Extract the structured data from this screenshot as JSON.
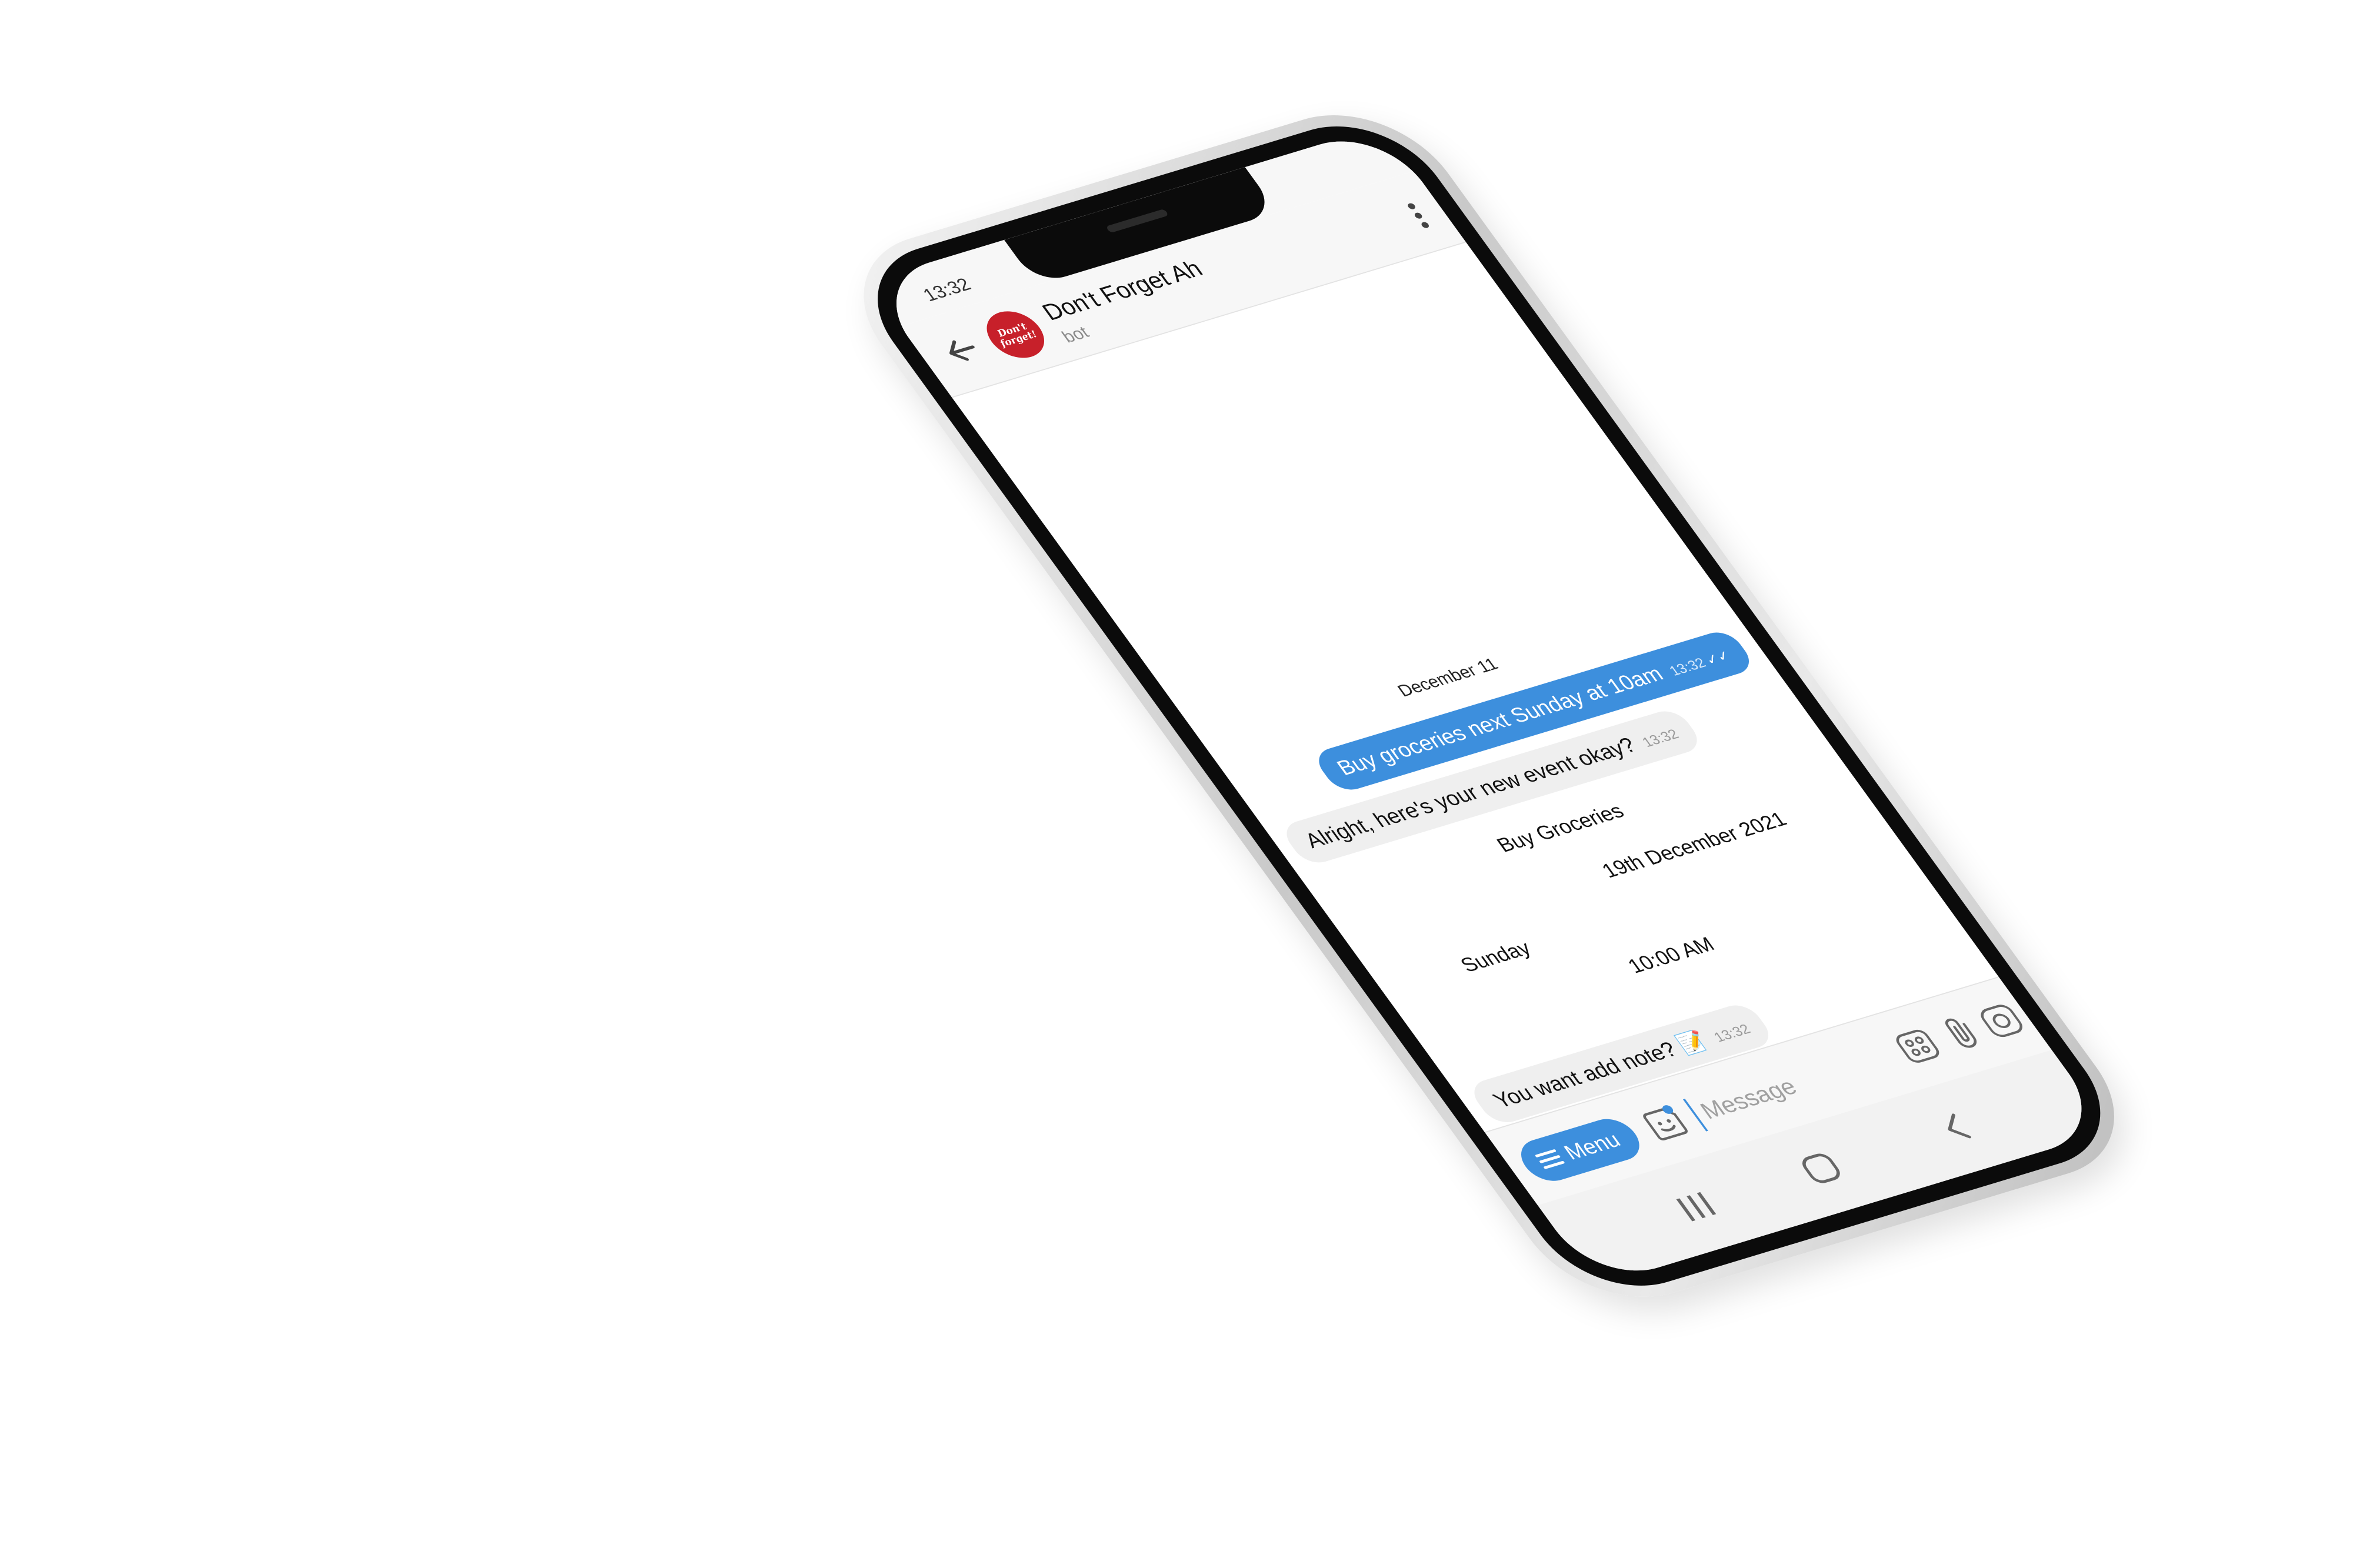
{
  "status_bar": {
    "time": "13:32"
  },
  "header": {
    "title": "Don't Forget Ah",
    "subtitle": "bot",
    "avatar_text": "Don't forget!"
  },
  "conversation": {
    "date_label": "December 11",
    "messages": [
      {
        "direction": "outgoing",
        "text": "Buy groceries next Sunday at 10am",
        "time": "13:32",
        "status": "✓✓"
      },
      {
        "direction": "incoming",
        "text": "Alright, here's your new event okay?",
        "time": "13:32"
      },
      {
        "direction": "incoming",
        "text": "You want add note? 📝",
        "time": "13:32"
      }
    ],
    "event": {
      "title": "Buy Groceries",
      "date": "19th December 2021",
      "day": "Sunday",
      "time": "10:00 AM"
    }
  },
  "composer": {
    "menu_label": "Menu",
    "placeholder": "Message"
  },
  "colors": {
    "accent": "#3d8fdd",
    "avatar_bg": "#c7202a",
    "incoming_bubble": "#efefef"
  },
  "icons": [
    "back-arrow-icon",
    "kebab-menu-icon",
    "hamburger-icon",
    "sticker-icon",
    "apps-icon",
    "paperclip-icon",
    "camera-icon",
    "nav-recents-icon",
    "nav-home-icon",
    "nav-back-icon"
  ]
}
